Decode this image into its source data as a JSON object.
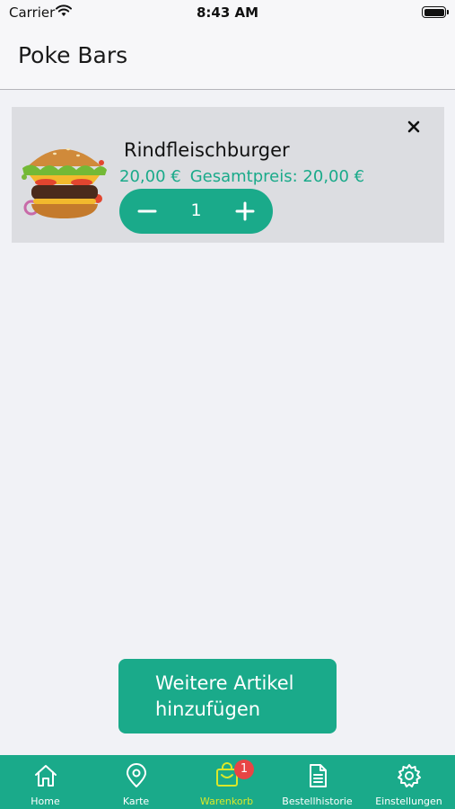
{
  "status_bar": {
    "carrier": "Carrier",
    "time": "8:43 AM"
  },
  "header": {
    "title": "Poke Bars"
  },
  "cart": {
    "items": [
      {
        "name": "Rindfleischburger",
        "price": "20,00 €",
        "total": "Gesamtpreis: 20,00 €",
        "quantity": "1"
      }
    ]
  },
  "add_more": {
    "line1": "Weitere Artikel",
    "line2": "hinzufügen"
  },
  "tabs": [
    {
      "label": "Home",
      "icon": "home-icon"
    },
    {
      "label": "Karte",
      "icon": "map-pin-icon"
    },
    {
      "label": "Warenkorb",
      "icon": "cart-icon",
      "active": true,
      "badge": "1"
    },
    {
      "label": "Bestellhistorie",
      "icon": "document-icon"
    },
    {
      "label": "Einstellungen",
      "icon": "gear-icon"
    }
  ],
  "colors": {
    "accent": "#1aaa8a",
    "active_tab": "#d9e82a",
    "badge": "#e84545",
    "item_bg": "#dcdde1"
  }
}
